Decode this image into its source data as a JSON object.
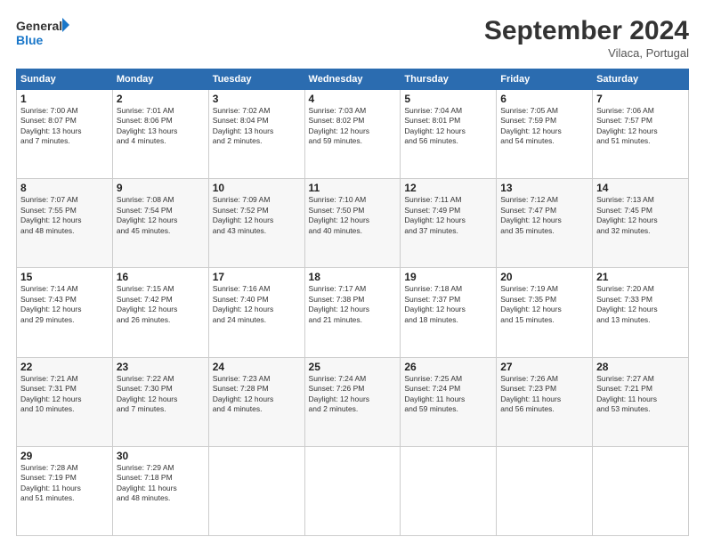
{
  "header": {
    "logo_line1": "General",
    "logo_line2": "Blue",
    "month": "September 2024",
    "location": "Vilaca, Portugal"
  },
  "weekdays": [
    "Sunday",
    "Monday",
    "Tuesday",
    "Wednesday",
    "Thursday",
    "Friday",
    "Saturday"
  ],
  "weeks": [
    [
      {
        "day": "1",
        "info": "Sunrise: 7:00 AM\nSunset: 8:07 PM\nDaylight: 13 hours\nand 7 minutes."
      },
      {
        "day": "2",
        "info": "Sunrise: 7:01 AM\nSunset: 8:06 PM\nDaylight: 13 hours\nand 4 minutes."
      },
      {
        "day": "3",
        "info": "Sunrise: 7:02 AM\nSunset: 8:04 PM\nDaylight: 13 hours\nand 2 minutes."
      },
      {
        "day": "4",
        "info": "Sunrise: 7:03 AM\nSunset: 8:02 PM\nDaylight: 12 hours\nand 59 minutes."
      },
      {
        "day": "5",
        "info": "Sunrise: 7:04 AM\nSunset: 8:01 PM\nDaylight: 12 hours\nand 56 minutes."
      },
      {
        "day": "6",
        "info": "Sunrise: 7:05 AM\nSunset: 7:59 PM\nDaylight: 12 hours\nand 54 minutes."
      },
      {
        "day": "7",
        "info": "Sunrise: 7:06 AM\nSunset: 7:57 PM\nDaylight: 12 hours\nand 51 minutes."
      }
    ],
    [
      {
        "day": "8",
        "info": "Sunrise: 7:07 AM\nSunset: 7:55 PM\nDaylight: 12 hours\nand 48 minutes."
      },
      {
        "day": "9",
        "info": "Sunrise: 7:08 AM\nSunset: 7:54 PM\nDaylight: 12 hours\nand 45 minutes."
      },
      {
        "day": "10",
        "info": "Sunrise: 7:09 AM\nSunset: 7:52 PM\nDaylight: 12 hours\nand 43 minutes."
      },
      {
        "day": "11",
        "info": "Sunrise: 7:10 AM\nSunset: 7:50 PM\nDaylight: 12 hours\nand 40 minutes."
      },
      {
        "day": "12",
        "info": "Sunrise: 7:11 AM\nSunset: 7:49 PM\nDaylight: 12 hours\nand 37 minutes."
      },
      {
        "day": "13",
        "info": "Sunrise: 7:12 AM\nSunset: 7:47 PM\nDaylight: 12 hours\nand 35 minutes."
      },
      {
        "day": "14",
        "info": "Sunrise: 7:13 AM\nSunset: 7:45 PM\nDaylight: 12 hours\nand 32 minutes."
      }
    ],
    [
      {
        "day": "15",
        "info": "Sunrise: 7:14 AM\nSunset: 7:43 PM\nDaylight: 12 hours\nand 29 minutes."
      },
      {
        "day": "16",
        "info": "Sunrise: 7:15 AM\nSunset: 7:42 PM\nDaylight: 12 hours\nand 26 minutes."
      },
      {
        "day": "17",
        "info": "Sunrise: 7:16 AM\nSunset: 7:40 PM\nDaylight: 12 hours\nand 24 minutes."
      },
      {
        "day": "18",
        "info": "Sunrise: 7:17 AM\nSunset: 7:38 PM\nDaylight: 12 hours\nand 21 minutes."
      },
      {
        "day": "19",
        "info": "Sunrise: 7:18 AM\nSunset: 7:37 PM\nDaylight: 12 hours\nand 18 minutes."
      },
      {
        "day": "20",
        "info": "Sunrise: 7:19 AM\nSunset: 7:35 PM\nDaylight: 12 hours\nand 15 minutes."
      },
      {
        "day": "21",
        "info": "Sunrise: 7:20 AM\nSunset: 7:33 PM\nDaylight: 12 hours\nand 13 minutes."
      }
    ],
    [
      {
        "day": "22",
        "info": "Sunrise: 7:21 AM\nSunset: 7:31 PM\nDaylight: 12 hours\nand 10 minutes."
      },
      {
        "day": "23",
        "info": "Sunrise: 7:22 AM\nSunset: 7:30 PM\nDaylight: 12 hours\nand 7 minutes."
      },
      {
        "day": "24",
        "info": "Sunrise: 7:23 AM\nSunset: 7:28 PM\nDaylight: 12 hours\nand 4 minutes."
      },
      {
        "day": "25",
        "info": "Sunrise: 7:24 AM\nSunset: 7:26 PM\nDaylight: 12 hours\nand 2 minutes."
      },
      {
        "day": "26",
        "info": "Sunrise: 7:25 AM\nSunset: 7:24 PM\nDaylight: 11 hours\nand 59 minutes."
      },
      {
        "day": "27",
        "info": "Sunrise: 7:26 AM\nSunset: 7:23 PM\nDaylight: 11 hours\nand 56 minutes."
      },
      {
        "day": "28",
        "info": "Sunrise: 7:27 AM\nSunset: 7:21 PM\nDaylight: 11 hours\nand 53 minutes."
      }
    ],
    [
      {
        "day": "29",
        "info": "Sunrise: 7:28 AM\nSunset: 7:19 PM\nDaylight: 11 hours\nand 51 minutes."
      },
      {
        "day": "30",
        "info": "Sunrise: 7:29 AM\nSunset: 7:18 PM\nDaylight: 11 hours\nand 48 minutes."
      },
      {
        "day": "",
        "info": ""
      },
      {
        "day": "",
        "info": ""
      },
      {
        "day": "",
        "info": ""
      },
      {
        "day": "",
        "info": ""
      },
      {
        "day": "",
        "info": ""
      }
    ]
  ]
}
